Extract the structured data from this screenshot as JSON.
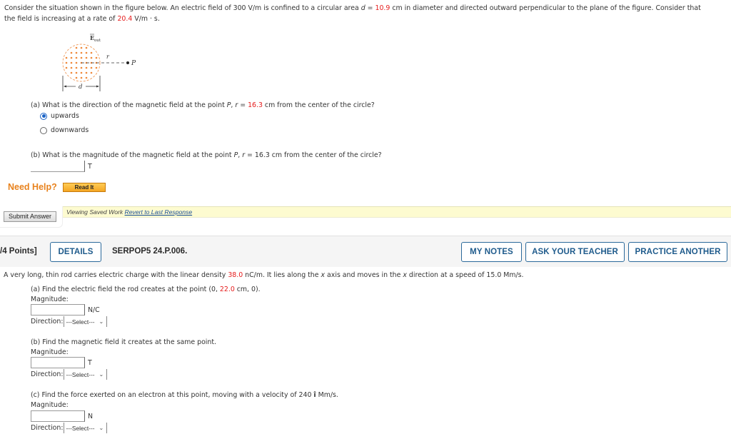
{
  "problem1": {
    "intro_line1_a": "Consider the situation shown in the figure below. An electric field of 300 V/m is confined to a circular area ",
    "intro_d_var": "d",
    "intro_eq": " = ",
    "intro_d_value": "10.9",
    "intro_line1_b": " cm in diameter and directed outward perpendicular to the plane of the figure. Consider that",
    "intro_line2_a": "the field is increasing at a rate of ",
    "intro_rate_value": "20.4",
    "intro_line2_b": " V/m · s.",
    "figure": {
      "field_label": "E",
      "field_subscript": "out",
      "r_label": "r",
      "point_label": "P",
      "d_label": "d",
      "dot_color": "#f0883a"
    },
    "part_a": {
      "question_a": "(a) What is the direction of the magnetic field at the point ",
      "point": "P",
      "comma": ", ",
      "r_var": "r",
      "eq": " = ",
      "r_value": "16.3",
      "question_b": " cm from the center of the circle?",
      "options": [
        {
          "label": "upwards",
          "selected": true
        },
        {
          "label": "downwards",
          "selected": false
        }
      ]
    },
    "part_b": {
      "question_a": "(b) What is the magnitude of the magnetic field at the point ",
      "point": "P",
      "comma": ", ",
      "r_var": "r",
      "eq": " = ",
      "r_value": "16.3",
      "question_b": " cm from the center of the circle?",
      "input_value": "",
      "unit": "T"
    },
    "need_help_label": "Need Help?",
    "read_it_label": "Read It",
    "submit_label": "Submit Answer",
    "saved_work_text": "Viewing Saved Work ",
    "revert_link": "Revert to Last Response"
  },
  "problem2": {
    "points_label": "/4 Points]",
    "details_label": "DETAILS",
    "problem_id": "SERPOP5 24.P.006.",
    "my_notes_label": "MY NOTES",
    "ask_teacher_label": "ASK YOUR TEACHER",
    "practice_another_label": "PRACTICE ANOTHER",
    "intro_a": "A very long, thin rod carries electric charge with the linear density ",
    "density_value": "38.0",
    "intro_b": " nC/m. It lies along the ",
    "x1": "x",
    "intro_c": " axis and moves in the ",
    "x2": "x",
    "intro_d": " direction at a speed of 15.0 Mm/s.",
    "part_a": {
      "question_a": "(a) Find the electric field the rod creates at the point (0, ",
      "y_value": "22.0",
      "question_b": " cm, 0).",
      "magnitude_label": "Magnitude:",
      "input_value": "",
      "unit": "N/C",
      "direction_label": "Direction:",
      "direction_selected": "---Select---"
    },
    "part_b": {
      "question": "(b) Find the magnetic field it creates at the same point.",
      "magnitude_label": "Magnitude:",
      "input_value": "",
      "unit": "T",
      "direction_label": "Direction:",
      "direction_selected": "---Select---"
    },
    "part_c": {
      "question_a": "(c) Find the force exerted on an electron at this point, moving with a velocity of 240 ",
      "unit_vector": "î",
      "question_b": " Mm/s.",
      "magnitude_label": "Magnitude:",
      "input_value": "",
      "unit": "N",
      "direction_label": "Direction:",
      "direction_selected": "---Select---"
    }
  }
}
